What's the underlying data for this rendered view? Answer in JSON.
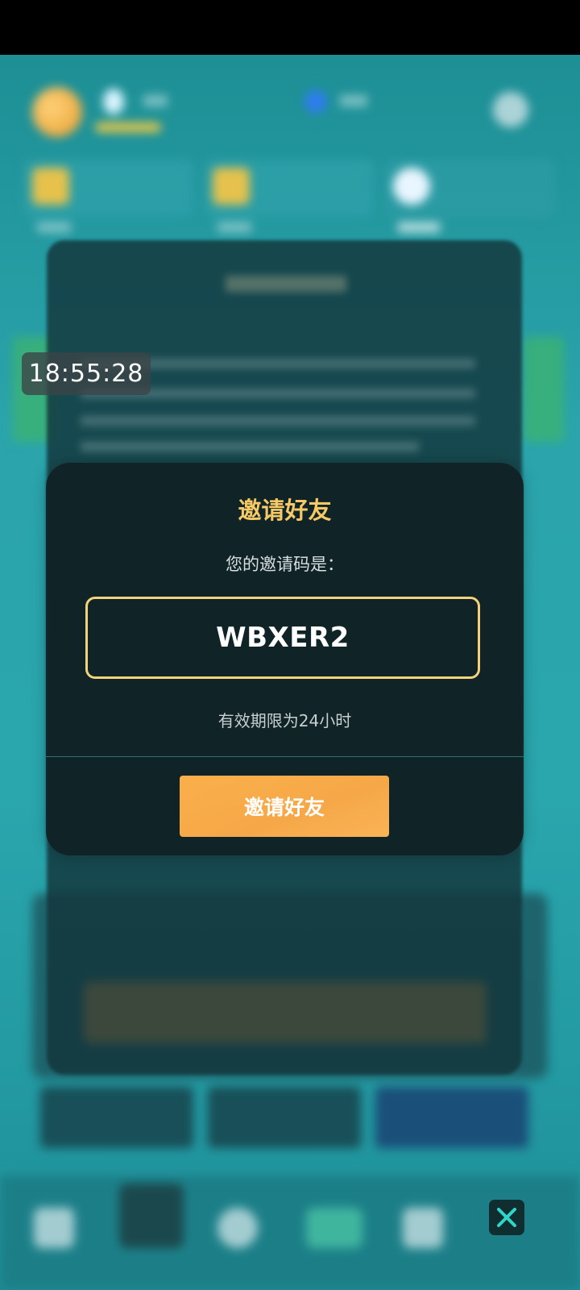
{
  "overlay": {
    "time": "18:55:28"
  },
  "dialog": {
    "title": "邀请好友",
    "subtitle": "您的邀请码是：",
    "invite_code": "WBXER2",
    "validity": "有效期限为24小时",
    "primary_button_label": "邀请好友"
  },
  "colors": {
    "title": "#f6c866",
    "code_border": "#f3d27c",
    "button": "#f6a848",
    "close_icon": "#2fd6c8"
  },
  "icons": {
    "close": "close-icon"
  }
}
